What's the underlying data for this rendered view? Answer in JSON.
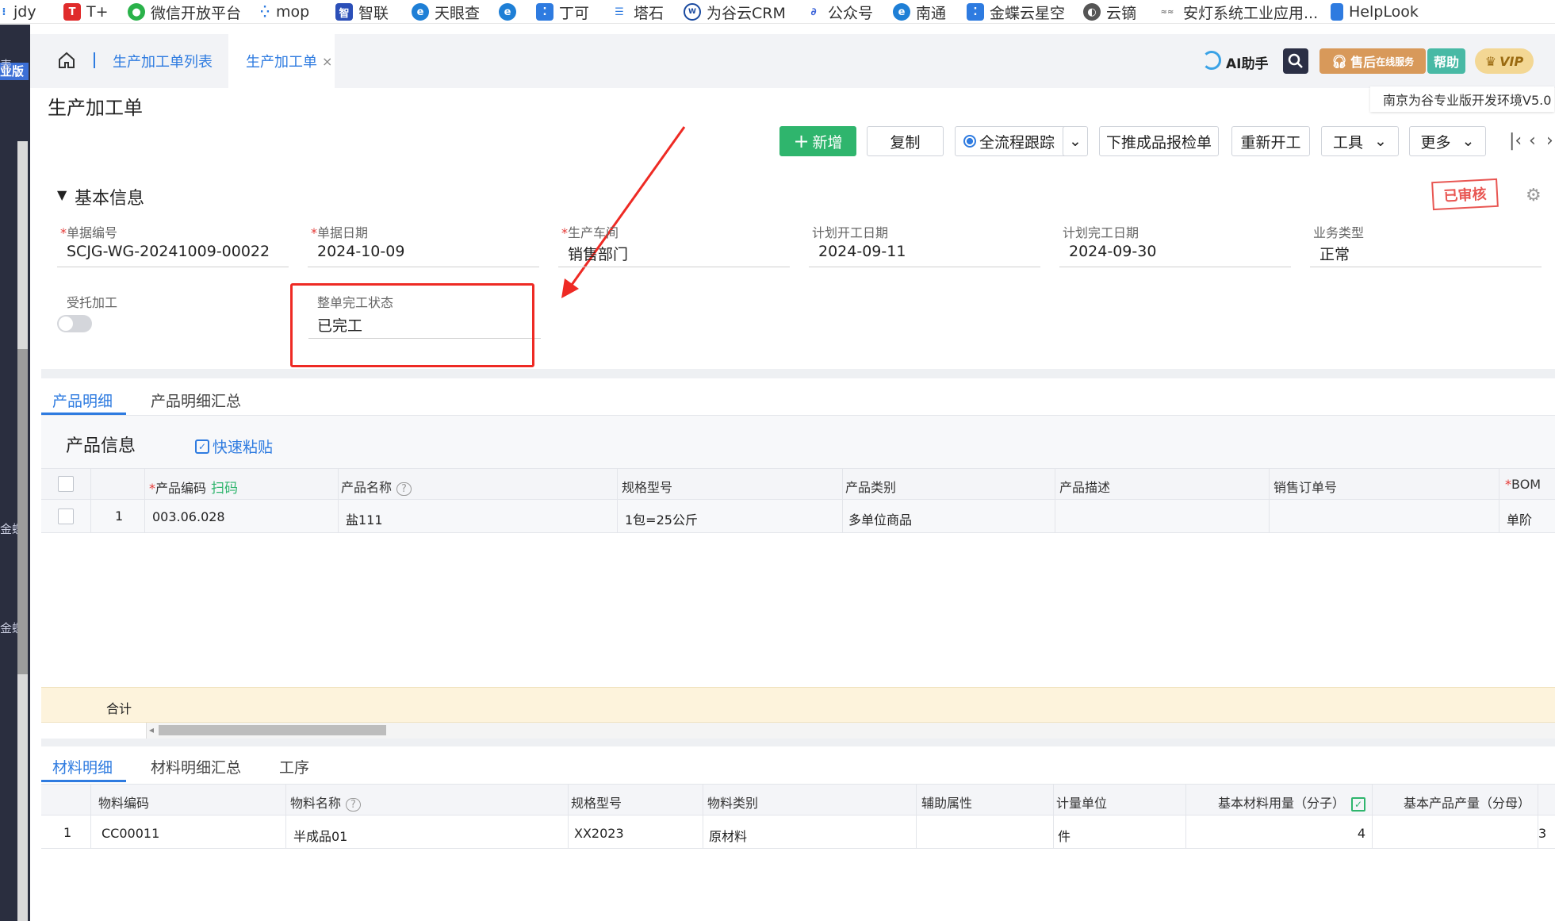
{
  "bookmarks": [
    {
      "label": "jdy",
      "icon": "jdy-icon"
    },
    {
      "label": "T+",
      "icon": "tplus-icon"
    },
    {
      "label": "微信开放平台",
      "icon": "wechat-icon"
    },
    {
      "label": "mop",
      "icon": "mop-icon"
    },
    {
      "label": "智联",
      "icon": "zhilian-icon"
    },
    {
      "label": "天眼查",
      "icon": "edge-icon"
    },
    {
      "label": "",
      "icon": "edge-icon"
    },
    {
      "label": "丁可",
      "icon": "dingke-icon"
    },
    {
      "label": "塔石",
      "icon": "list-icon"
    },
    {
      "label": "为谷云CRM",
      "icon": "crm-icon"
    },
    {
      "label": "公众号",
      "icon": "link-icon"
    },
    {
      "label": "南通",
      "icon": "edge-icon"
    },
    {
      "label": "金蝶云星空",
      "icon": "kingdee-icon"
    },
    {
      "label": "云镝",
      "icon": "globe-icon"
    },
    {
      "label": "安灯系统工业应用...",
      "icon": "andon-icon"
    },
    {
      "label": "HelpLook",
      "icon": "bookmark-icon"
    }
  ],
  "sidebar": {
    "badge": "业版",
    "sub_badge": "表",
    "items": [
      "金蝶",
      "金蝶"
    ]
  },
  "tabs": {
    "list": "生产加工单列表",
    "active": "生产加工单",
    "close": "×"
  },
  "header": {
    "ai_label": "AI助手",
    "service_label": "售后",
    "service_sub": "在线服务",
    "help_label": "帮助",
    "vip_label": "VIP",
    "env_label": "南京为谷专业版开发环境V5.0"
  },
  "page_title": "生产加工单",
  "toolbar": {
    "new": "新增",
    "copy": "复制",
    "trace": "全流程跟踪",
    "push_inspect": "下推成品报检单",
    "restart": "重新开工",
    "tools": "工具",
    "more": "更多"
  },
  "basic_info": {
    "section_title": "基本信息",
    "stamp": "已审核",
    "fields": [
      {
        "label": "单据编号",
        "required": true,
        "value": "SCJG-WG-20241009-00022"
      },
      {
        "label": "单据日期",
        "required": true,
        "value": "2024-10-09"
      },
      {
        "label": "生产车间",
        "required": true,
        "value": "销售部门"
      },
      {
        "label": "计划开工日期",
        "required": false,
        "value": "2024-09-11"
      },
      {
        "label": "计划完工日期",
        "required": false,
        "value": "2024-09-30"
      },
      {
        "label": "业务类型",
        "required": false,
        "value": "正常"
      }
    ],
    "outsource_label": "受托加工",
    "outsource_on": false,
    "complete_label": "整单完工状态",
    "complete_value": "已完工"
  },
  "product_tabs": [
    "产品明细",
    "产品明细汇总"
  ],
  "product_section": {
    "title": "产品信息",
    "quick_paste": "快速粘贴",
    "scan": "扫码"
  },
  "product_grid": {
    "headers": [
      "产品编码",
      "产品名称",
      "规格型号",
      "产品类别",
      "产品描述",
      "销售订单号",
      "BOM"
    ],
    "rows": [
      {
        "no": "1",
        "code": "003.06.028",
        "name": "盐111",
        "spec": "1包=25公斤",
        "category": "多单位商品",
        "desc": "",
        "so": "",
        "bom": "单阶"
      }
    ],
    "sum_label": "合计"
  },
  "material_tabs": [
    "材料明细",
    "材料明细汇总",
    "工序"
  ],
  "material_grid": {
    "headers": [
      "物料编码",
      "物料名称",
      "规格型号",
      "物料类别",
      "辅助属性",
      "计量单位",
      "基本材料用量（分子）",
      "基本产品产量（分母）"
    ],
    "rows": [
      {
        "no": "1",
        "code": "CC00011",
        "name": "半成品01",
        "spec": "XX2023",
        "category": "原材料",
        "aux": "",
        "unit": "件",
        "qty": "4",
        "base": "3"
      }
    ]
  },
  "colors": {
    "accent": "#2e7be0",
    "green": "#2fb56d",
    "annotation": "#ee2a24",
    "stamp": "#e53935"
  }
}
